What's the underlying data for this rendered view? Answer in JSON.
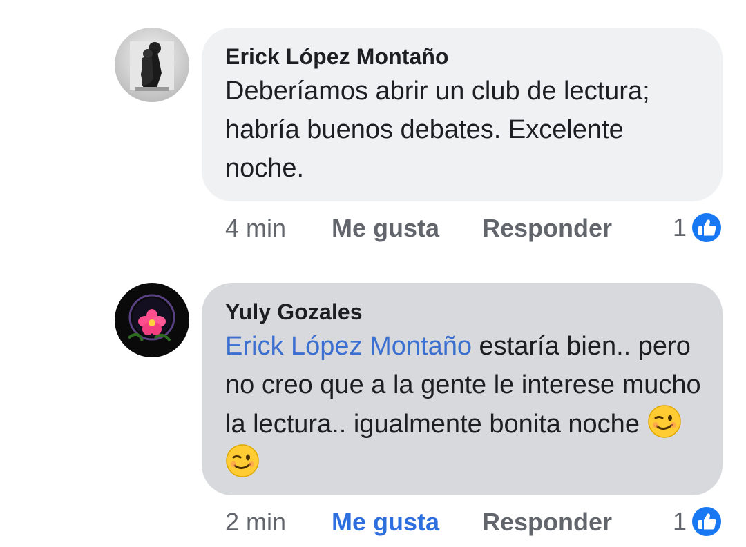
{
  "comments": [
    {
      "author": "Erick López Montaño",
      "text": "Deberíamos abrir un club de lectura; habría buenos debates. Excelente noche.",
      "time": "4 min",
      "like_label": "Me gusta",
      "reply_label": "Responder",
      "reaction_count": "1",
      "liked_by_me": false
    },
    {
      "author": "Yuly Gozales",
      "mention": "Erick López Montaño",
      "text": "estaría bien.. pero no creo que a la gente le interese mucho la lectura.. igualmente bonita noche",
      "emojis": [
        "winking-face",
        "winking-face"
      ],
      "time": "2 min",
      "like_label": "Me gusta",
      "reply_label": "Responder",
      "reaction_count": "1",
      "liked_by_me": true
    }
  ],
  "colors": {
    "bubble_1": "#f0f1f3",
    "bubble_2": "#d8d9dc",
    "mention": "#3b6fd0",
    "like_active": "#2e6fe0",
    "meta_text": "#62666c"
  },
  "icons": {
    "reaction": "like-thumb-icon",
    "emoji": "winking-face-icon"
  }
}
